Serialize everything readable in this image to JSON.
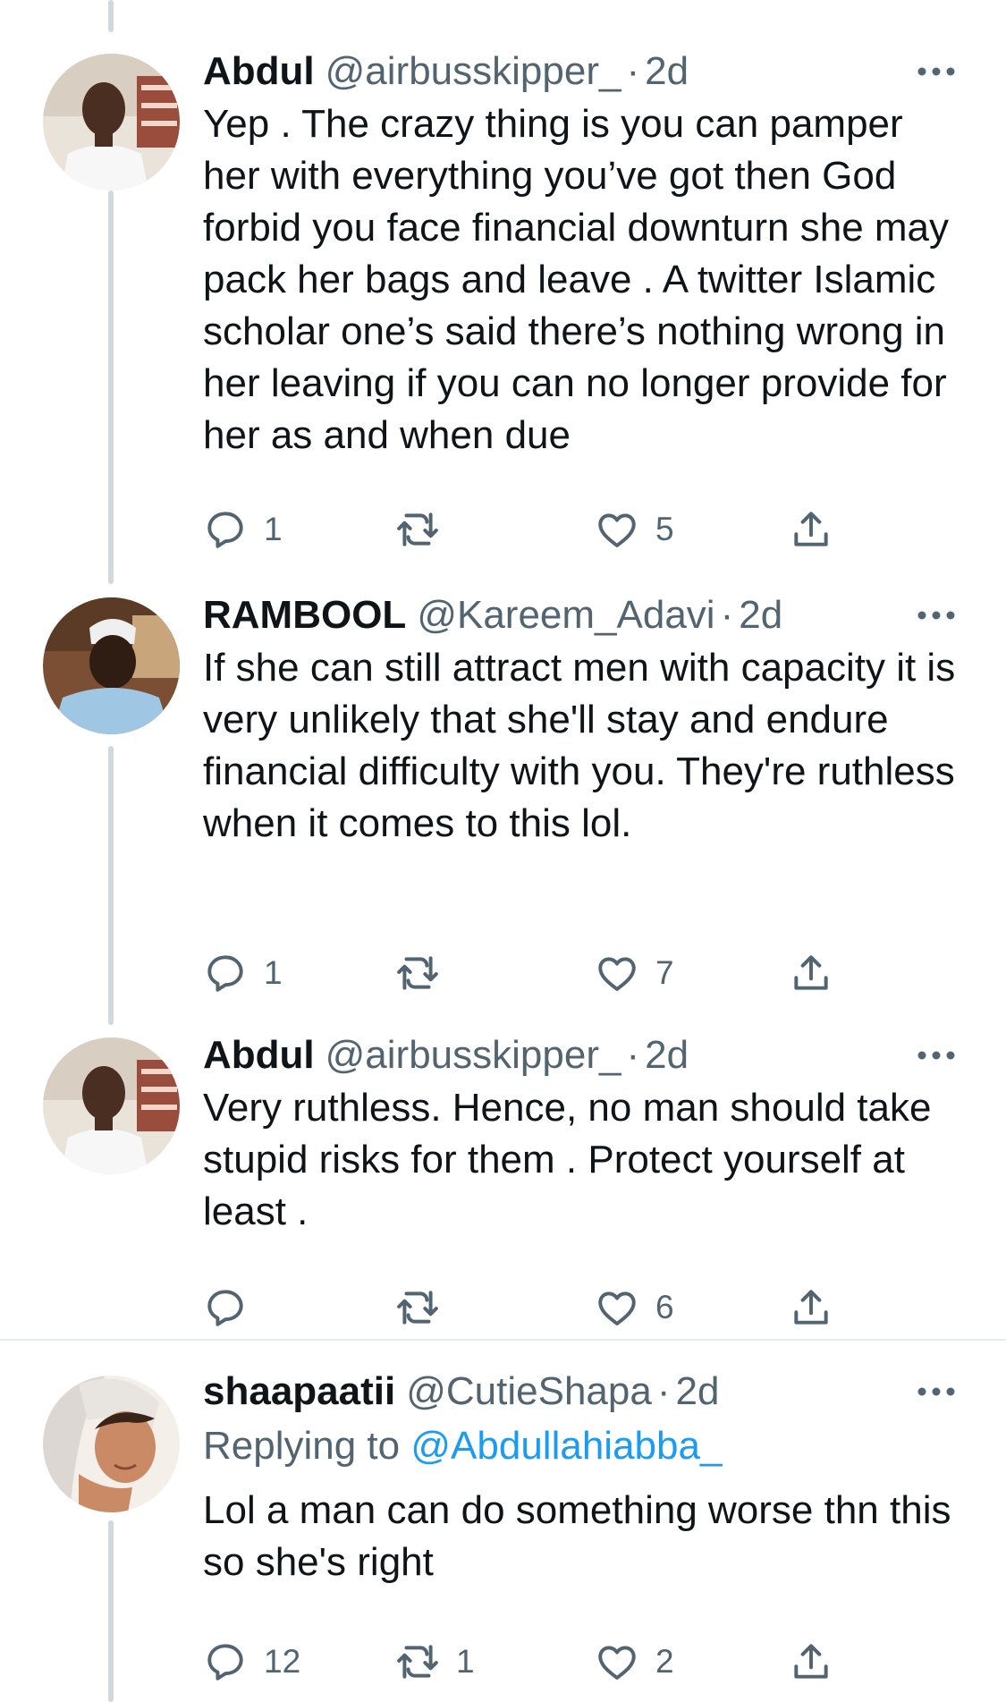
{
  "tweets": [
    {
      "name": "Abdul",
      "handle": "@airbusskipper_",
      "dot": "·",
      "time": "2d",
      "text": "Yep . The crazy thing is you can pamper her with everything you’ve got then God forbid you face financial downturn she may pack her bags and leave . A twitter Islamic scholar one’s said there’s nothing wrong in her leaving if you can no longer provide for her as and when due",
      "replies": "1",
      "retweets": "",
      "likes": "5",
      "avatar_icon": "avatar-abdul"
    },
    {
      "name": "RAMBOOL",
      "handle": "@Kareem_Adavi",
      "dot": "·",
      "time": "2d",
      "text": "If she can still attract men with capacity it is very unlikely that she'll stay and endure financial difficulty with you. They're ruthless when it comes to this lol.",
      "replies": "1",
      "retweets": "",
      "likes": "7",
      "avatar_icon": "avatar-rambool"
    },
    {
      "name": "Abdul",
      "handle": "@airbusskipper_",
      "dot": "·",
      "time": "2d",
      "text": "Very ruthless. Hence, no man should take stupid risks for them . Protect yourself at least .",
      "replies": "",
      "retweets": "",
      "likes": "6",
      "avatar_icon": "avatar-abdul"
    },
    {
      "name": "shaapaatii",
      "handle": "@CutieShapa",
      "dot": "·",
      "time": "2d",
      "replying_prefix": "Replying to",
      "replying_to": "@Abdullahiabba_",
      "text": "Lol a man can do something worse thn this so she's right",
      "replies": "12",
      "retweets": "1",
      "likes": "2",
      "avatar_icon": "avatar-shaapaatii"
    }
  ],
  "colors": {
    "text": "#0f1419",
    "secondary": "#536471",
    "link": "#1d9bf0",
    "thread_line": "#cfd9de"
  },
  "icons": {
    "reply": "reply-icon",
    "retweet": "retweet-icon",
    "like": "like-icon",
    "share": "share-icon",
    "more": "more-icon"
  }
}
